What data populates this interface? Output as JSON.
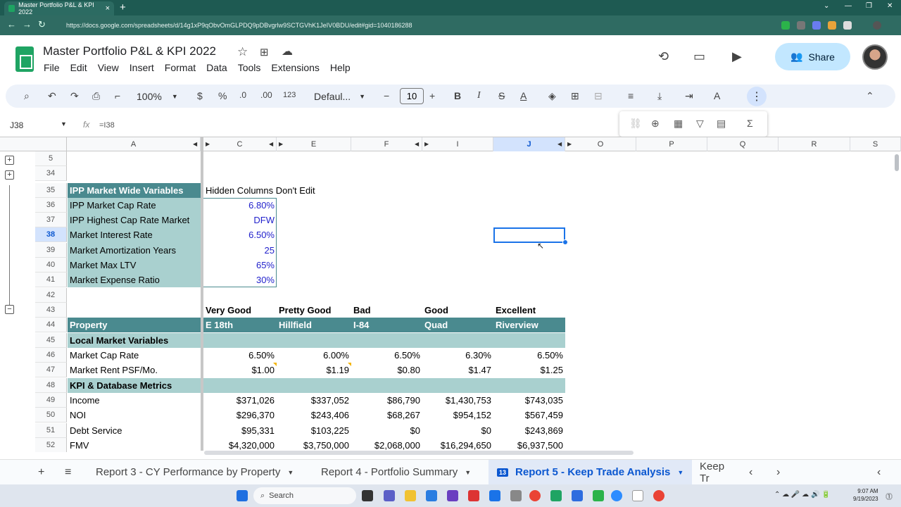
{
  "browser": {
    "tab_title": "Master Portfolio P&L & KPI 2022",
    "tab_close": "×",
    "new_tab": "+",
    "url": "https://docs.google.com/spreadsheets/d/14g1xP9qObvOmGLPDQ9pDBvgrlw9SCTGVhK1JeIV0BDU/edit#gid=1040186288"
  },
  "app": {
    "doc_title": "Master Portfolio P&L & KPI  2022",
    "menus": [
      "File",
      "Edit",
      "View",
      "Insert",
      "Format",
      "Data",
      "Tools",
      "Extensions",
      "Help"
    ],
    "share_label": "Share"
  },
  "toolbar": {
    "zoom": "100%",
    "currency": "$",
    "percent": "%",
    "dec_decrease": ".0",
    "dec_increase": ".00",
    "number_format": "123",
    "font": "Defaul...",
    "font_size": "10",
    "bold": "B",
    "italic": "I",
    "strike": "S",
    "text_color": "A"
  },
  "formula_bar": {
    "name_box": "J38",
    "fx": "fx",
    "formula": "=I38"
  },
  "columns": [
    "A",
    "C",
    "E",
    "F",
    "I",
    "J",
    "O",
    "P",
    "Q",
    "R",
    "S"
  ],
  "rows": [
    "5",
    "34",
    "35",
    "36",
    "37",
    "38",
    "39",
    "40",
    "41",
    "42",
    "43",
    "44",
    "45",
    "46",
    "47",
    "48",
    "49",
    "50",
    "51",
    "52"
  ],
  "market": {
    "header": "IPP Market Wide Variables",
    "note": "Hidden Columns Don't Edit",
    "items": [
      {
        "label": "IPP Market Cap Rate",
        "value": "6.80%"
      },
      {
        "label": "IPP Highest Cap Rate Market",
        "value": "DFW"
      },
      {
        "label": "Market Interest Rate",
        "value": "6.50%"
      },
      {
        "label": "Market Amortization Years",
        "value": "25"
      },
      {
        "label": "Market Max LTV",
        "value": "65%"
      },
      {
        "label": "Market Expense Ratio",
        "value": "30%"
      }
    ]
  },
  "properties": {
    "ratings": [
      "Very Good",
      "Pretty Good",
      "Bad",
      "Good",
      "Excellent"
    ],
    "header_label": "Property",
    "names": [
      "E 18th",
      "Hillfield",
      "I-84",
      "Quad",
      "Riverview"
    ],
    "section_local": "Local Market Variables",
    "section_kpi": "KPI & Database Metrics",
    "metrics": [
      {
        "label": "Market Cap Rate",
        "values": [
          "6.50%",
          "6.00%",
          "6.50%",
          "6.30%",
          "6.50%"
        ]
      },
      {
        "label": "Market Rent PSF/Mo.",
        "values": [
          "$1.00",
          "$1.19",
          "$0.80",
          "$1.47",
          "$1.25"
        ]
      },
      {
        "label": "Income",
        "values": [
          "$371,026",
          "$337,052",
          "$86,790",
          "$1,430,753",
          "$743,035"
        ]
      },
      {
        "label": "NOI",
        "values": [
          "$296,370",
          "$243,406",
          "$68,267",
          "$954,152",
          "$567,459"
        ]
      },
      {
        "label": "Debt Service",
        "values": [
          "$95,331",
          "$103,225",
          "$0",
          "$0",
          "$243,869"
        ]
      },
      {
        "label": "FMV",
        "values": [
          "$4,320,000",
          "$3,750,000",
          "$2,068,000",
          "$16,294,650",
          "$6,937,500"
        ]
      }
    ]
  },
  "sheet_tabs": [
    {
      "label": "Report 3 - CY Performance by Property"
    },
    {
      "label": "Report 4 - Portfolio Summary"
    },
    {
      "label": "Report 5 - Keep Trade Analysis",
      "badge": "13"
    },
    {
      "label": "Keep Tr"
    }
  ],
  "taskbar": {
    "search": "Search",
    "time": "9:07 AM",
    "date": "9/19/2023"
  },
  "colors": {
    "teal_header": "#4a8a8f",
    "teal_light": "#a9d0cf",
    "selection": "#1a73e8",
    "value_blue": "#2222cc"
  }
}
